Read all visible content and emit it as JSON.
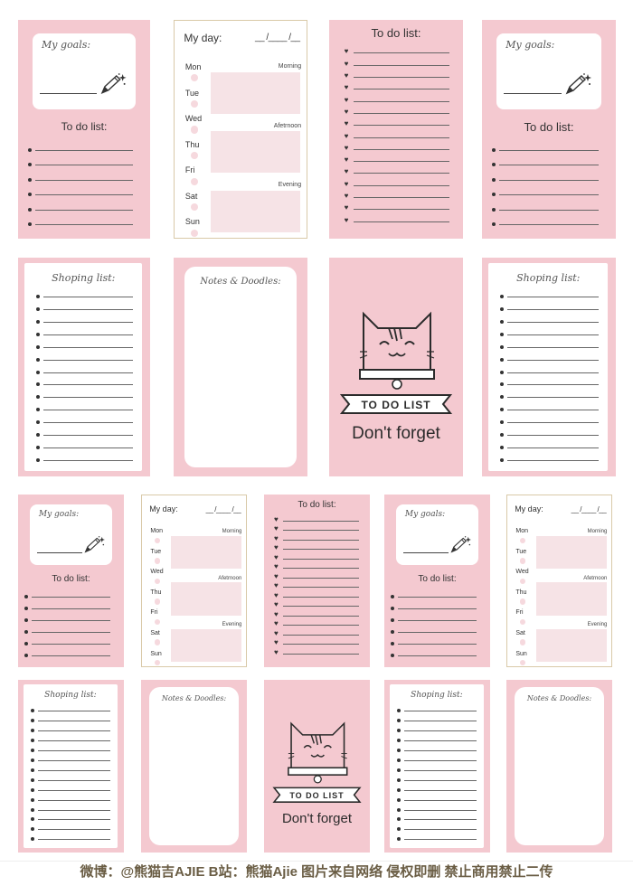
{
  "labels": {
    "my_goals": "My goals:",
    "to_do_list": "To do list:",
    "my_day": "My day:",
    "date_blank": "__ /____ /__",
    "shoping_list": "Shoping list:",
    "notes_doodles": "Notes & Doodles:",
    "to_do_list_banner": "TO DO LIST",
    "dont_forget": "Don't forget"
  },
  "days": [
    "Mon",
    "Tue",
    "Wed",
    "Thu",
    "Fri",
    "Sat",
    "Sun"
  ],
  "slots": [
    "Morning",
    "Afetrnoon",
    "Evening"
  ],
  "footer": "微博：@熊猫吉AJIE B站：熊猫Ajie 图片来自网络 侵权即删 禁止商用禁止二传",
  "colors": {
    "pink": "#f4c9d0",
    "box": "#f6e3e6",
    "footer": "#6a5d44"
  }
}
